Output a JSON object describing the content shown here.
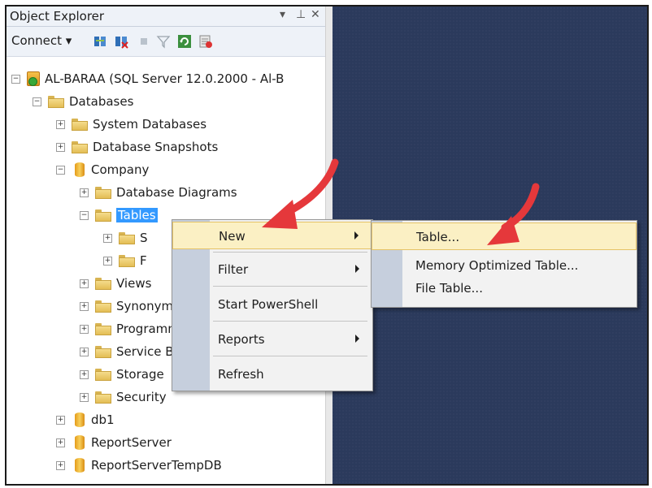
{
  "object_explorer": {
    "title": "Object Explorer",
    "pin_glyph": "▾ ⫠ ✕",
    "toolbar": {
      "connect_label": "Connect ▾",
      "icons": [
        "connect-icon",
        "disconnect-icon",
        "stop-icon",
        "filter-icon",
        "refresh-icon",
        "activity-monitor-icon"
      ]
    },
    "tree": [
      {
        "label": "AL-BARAA (SQL Server 12.0.2000 - Al-B",
        "icon": "server",
        "expander": "−"
      },
      {
        "label": "Databases",
        "icon": "folder",
        "expander": "−"
      },
      {
        "label": "System Databases",
        "icon": "folder",
        "expander": "+"
      },
      {
        "label": "Database Snapshots",
        "icon": "folder",
        "expander": "+"
      },
      {
        "label": "Company",
        "icon": "database",
        "expander": "−"
      },
      {
        "label": "Database Diagrams",
        "icon": "folder",
        "expander": "+"
      },
      {
        "label": "Tables",
        "icon": "folder",
        "expander": "−"
      },
      {
        "label": "S",
        "icon": "folder",
        "expander": "+"
      },
      {
        "label": "F",
        "icon": "folder",
        "expander": "+"
      },
      {
        "label": "Views",
        "icon": "folder",
        "expander": "+"
      },
      {
        "label": "Synonyms",
        "icon": "folder",
        "expander": "+"
      },
      {
        "label": "Programmability",
        "icon": "folder",
        "expander": "+"
      },
      {
        "label": "Service Broker",
        "icon": "folder",
        "expander": "+"
      },
      {
        "label": "Storage",
        "icon": "folder",
        "expander": "+"
      },
      {
        "label": "Security",
        "icon": "folder",
        "expander": "+"
      },
      {
        "label": "db1",
        "icon": "database",
        "expander": "+"
      },
      {
        "label": "ReportServer",
        "icon": "database",
        "expander": "+"
      },
      {
        "label": "ReportServerTempDB",
        "icon": "database",
        "expander": "+"
      }
    ]
  },
  "context_menu": {
    "items": [
      "New",
      "Filter",
      "Start PowerShell",
      "Reports",
      "Refresh"
    ]
  },
  "submenu": {
    "items": [
      "Table...",
      "Memory Optimized Table...",
      "File Table..."
    ]
  },
  "colors": {
    "workspace": "#2b3a5c",
    "highlight": "#fbf0c4",
    "arrow": "#e5383b",
    "selection": "#3399ff"
  }
}
